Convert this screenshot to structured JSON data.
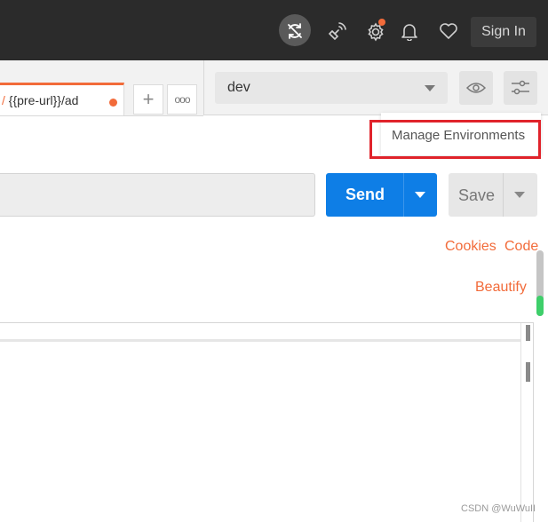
{
  "topbar": {
    "icons": [
      "sync-off-icon",
      "satellite-icon",
      "settings-icon",
      "bell-icon",
      "heart-icon"
    ],
    "sign_in_label": "Sign In",
    "notification_color": "#f26b3a"
  },
  "tabs": {
    "active": {
      "prefix": "/",
      "label": "{{pre-url}}/ad",
      "unsaved": true
    },
    "add_label": "+",
    "more_label": "ooo"
  },
  "environment": {
    "selected": "dev",
    "manage_tooltip": "Manage Environments"
  },
  "request": {
    "send_label": "Send",
    "save_label": "Save",
    "send_color": "#0e7ee6"
  },
  "links": {
    "cookies": "Cookies",
    "code": "Code",
    "beautify": "Beautify"
  },
  "watermark": "CSDN @WuWuII"
}
